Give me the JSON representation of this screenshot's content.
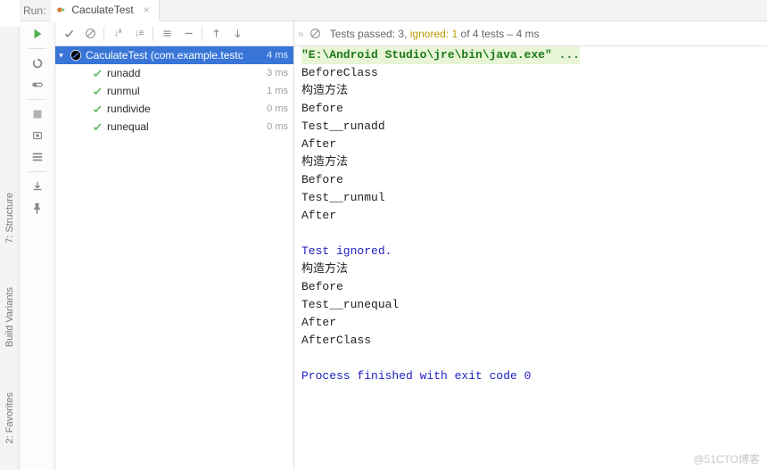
{
  "header": {
    "run_label": "Run:",
    "tab_title": "CaculateTest"
  },
  "status": {
    "prefix": "Tests passed:",
    "passed": "3",
    "mid": ",",
    "ignored_label": "ignored:",
    "ignored": "1",
    "suffix": "of 4 tests – 4 ms"
  },
  "tree": {
    "root": {
      "name": "CaculateTest (com.example.testc",
      "time": "4 ms"
    },
    "children": [
      {
        "name": "runadd",
        "time": "3 ms",
        "icon": "check"
      },
      {
        "name": "runmul",
        "time": "1 ms",
        "icon": "check"
      },
      {
        "name": "rundivide",
        "time": "0 ms",
        "icon": "check"
      },
      {
        "name": "runequal",
        "time": "0 ms",
        "icon": "check"
      }
    ]
  },
  "console": {
    "l0": "\"E:\\Android Studio\\jre\\bin\\java.exe\" ...",
    "l1": "BeforeClass",
    "l2": "构造方法",
    "l3": "Before",
    "l4": "Test__runadd",
    "l5": "After",
    "l6": "构造方法",
    "l7": "Before",
    "l8": "Test__runmul",
    "l9": "After",
    "lblank1": "",
    "l10": "Test ignored.",
    "l11": "构造方法",
    "l12": "Before",
    "l13": "Test__runequal",
    "l14": "After",
    "l15": "AfterClass",
    "lblank2": "",
    "l16": "Process finished with exit code 0"
  },
  "side": {
    "structure": "7: Structure",
    "variants": "Build Variants",
    "favorites": "2: Favorites"
  },
  "watermark": "@51CTO博客"
}
